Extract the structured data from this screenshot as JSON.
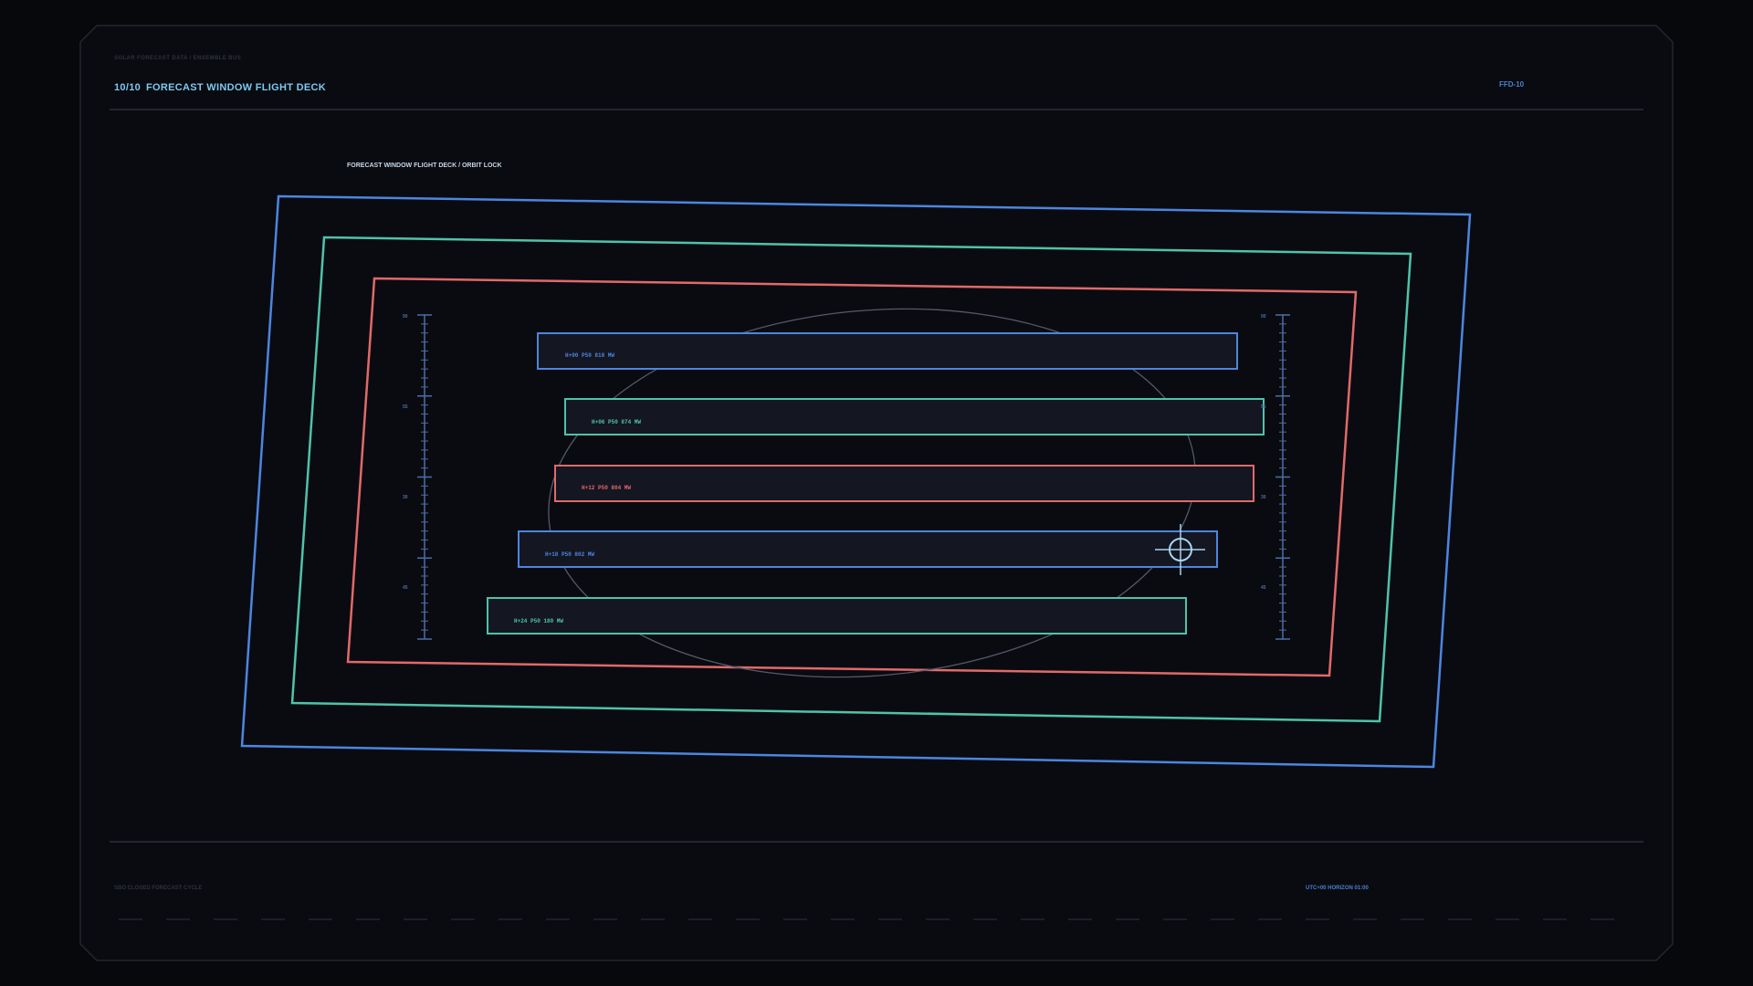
{
  "header": {
    "sub_label": "SOLAR FORECAST DATA / ENSEMBLE BUS",
    "page_counter": "10/10",
    "title": "FORECAST WINDOW FLIGHT DECK",
    "deck_id": "FFD-10"
  },
  "deck": {
    "caption": "FORECAST WINDOW FLIGHT DECK / ORBIT LOCK",
    "gauge_left_ticks": [
      "90",
      "55",
      "30",
      "45"
    ],
    "gauge_right_ticks": [
      "90",
      "55",
      "30",
      "45"
    ],
    "bars": [
      {
        "label": "H+00  P50 818 MW",
        "color": "#4c86e0"
      },
      {
        "label": "H+06  P50 874 MW",
        "color": "#4fc3a9"
      },
      {
        "label": "H+12  P50 804 MW",
        "color": "#e06a6a"
      },
      {
        "label": "H+18  P50 802 MW",
        "color": "#4c86e0"
      },
      {
        "label": "H+24  P50 180 MW",
        "color": "#4fc3a9"
      }
    ]
  },
  "footer": {
    "left": "SBO CLOSED FORECAST CYCLE",
    "right": "UTC+00  HORIZON 01:00"
  },
  "colors": {
    "background": "#07080c",
    "blue": "#4c86e0",
    "teal": "#4fc3a9",
    "red": "#e06a6a",
    "crosshair": "#a8d4f0"
  }
}
